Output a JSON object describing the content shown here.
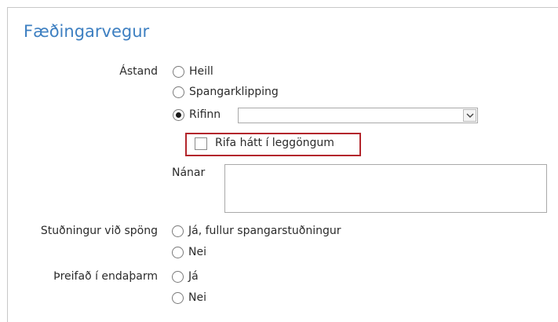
{
  "section": {
    "title": "Fæðingarvegur"
  },
  "astand": {
    "label": "Ástand",
    "options": [
      "Heill",
      "Spangarklipping",
      "Rifinn"
    ],
    "selected": "Rifinn",
    "rifinn_select_value": "",
    "checkbox_label": "Rifa hátt í leggöngum",
    "checkbox_checked": false,
    "nanar_label": "Nánar",
    "nanar_value": ""
  },
  "studningur": {
    "label": "Stuðningur við spöng",
    "options": [
      "Já, fullur spangarstuðningur",
      "Nei"
    ],
    "selected": ""
  },
  "threifad": {
    "label": "Þreifað í endaþarm",
    "options": [
      "Já",
      "Nei"
    ],
    "selected": ""
  },
  "colors": {
    "title": "#3d7fc1",
    "highlight": "#b3262c"
  },
  "icons": {
    "select_arrow": "chevron-down-icon"
  }
}
